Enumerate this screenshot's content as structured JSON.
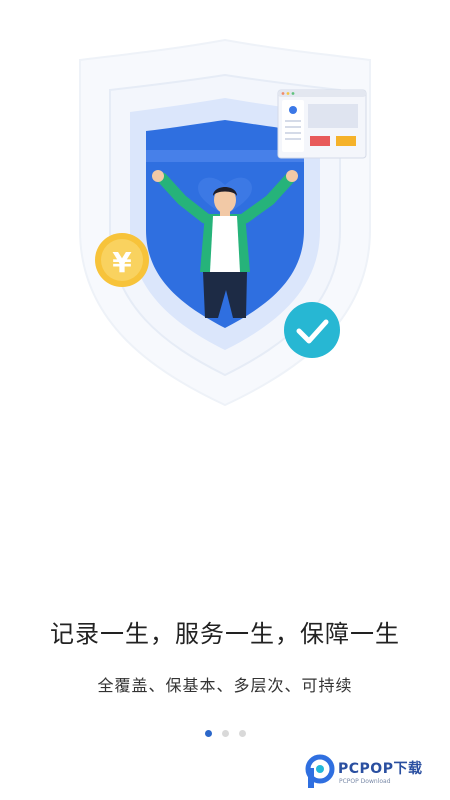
{
  "hero": {
    "illustration_icon": "shield-person-icon",
    "coin_symbol": "¥",
    "colors": {
      "shield_blue": "#2f6fe0",
      "shield_light": "#e8efff",
      "person_green": "#26b37a",
      "coin_gold": "#f7c33a",
      "check_cyan": "#27b7d3"
    }
  },
  "headline": "记录一生，服务一生，保障一生",
  "subline": "全覆盖、保基本、多层次、可持续",
  "pager": {
    "pages": [
      {
        "active": true
      },
      {
        "active": false
      },
      {
        "active": false
      }
    ]
  },
  "watermark": {
    "brand": "PCPOP下载",
    "subtext": "PCPOP Download"
  }
}
